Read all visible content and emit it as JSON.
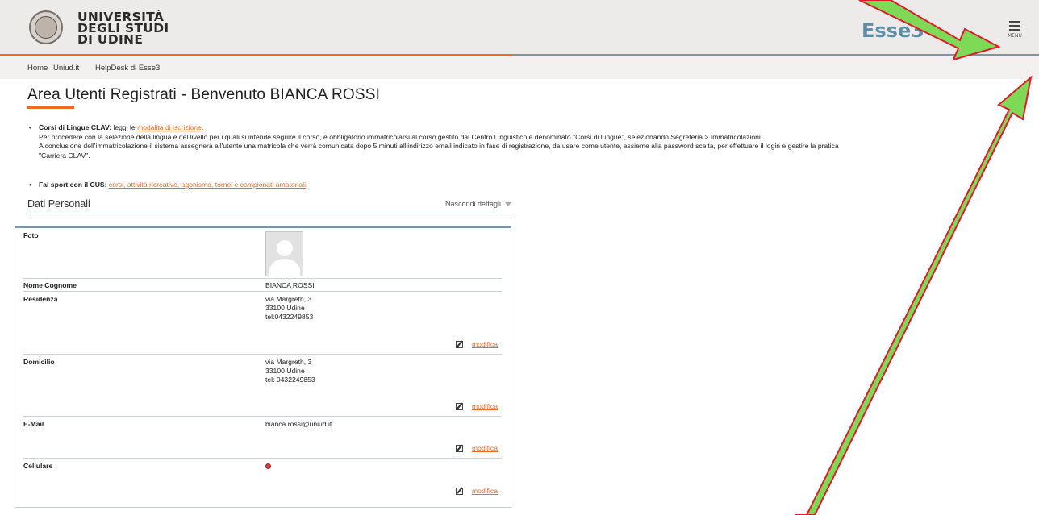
{
  "header": {
    "logo_line1": "UNIVERSITÀ",
    "logo_line2": "DEGLI STUDI",
    "logo_line3": "DI UDINE",
    "app_name": "Esse3",
    "menu_label": "MENU"
  },
  "breadcrumb": {
    "items": [
      "Home",
      "Uniud.it",
      "HelpDesk di Esse3"
    ]
  },
  "page": {
    "title": "Area Utenti Registrati - Benvenuto BIANCA ROSSI"
  },
  "notices": {
    "clav_label": "Corsi di Lingue CLAV:",
    "clav_text": " leggi le ",
    "clav_link": "modalità di iscrizione",
    "clav_line2": "Per procedere con la selezione della lingua e del livello per i quali si intende seguire il corso, è obbligatorio immatricolarsi al corso gestito dal Centro Linguistico e denominato \"Corsi di Lingue\", selezionando Segreteria > Immatricolazioni.",
    "clav_line3": "A conclusione dell'immatricolazione il sistema assegnerà all'utente una matricola che verrà comunicata dopo 5 minuti all'indirizzo email indicato in fase di registrazione, da usare come utente, assieme alla password scelta, per effettuare il login e gestire la pratica",
    "clav_line4": "\"Carriera CLAV\".",
    "cus_label": "Fai sport con il CUS:",
    "cus_link": "corsi, attività ricreative, agonismo, tornei e campionati amatoriali"
  },
  "section": {
    "title": "Dati Personali",
    "toggle_label": "Nascondi dettagli"
  },
  "fields": {
    "foto_label": "Foto",
    "name_label": "Nome Cognome",
    "name_value": "BIANCA ROSSI",
    "residenza_label": "Residenza",
    "residenza_line1": "via Margreth, 3",
    "residenza_line2": "33100 Udine",
    "residenza_line3": "tel:0432249853",
    "domicilio_label": "Domicilio",
    "domicilio_line1": "via Margreth, 3",
    "domicilio_line2": "33100 Udine",
    "domicilio_line3": "tel: 0432249853",
    "email_label": "E-Mail",
    "email_value": "bianca.rossi@uniud.it",
    "cellulare_label": "Cellulare",
    "edit_label": "modifica"
  },
  "annotations": {
    "arrow_color": "#7ed957",
    "arrow_border": "#e0192b"
  }
}
